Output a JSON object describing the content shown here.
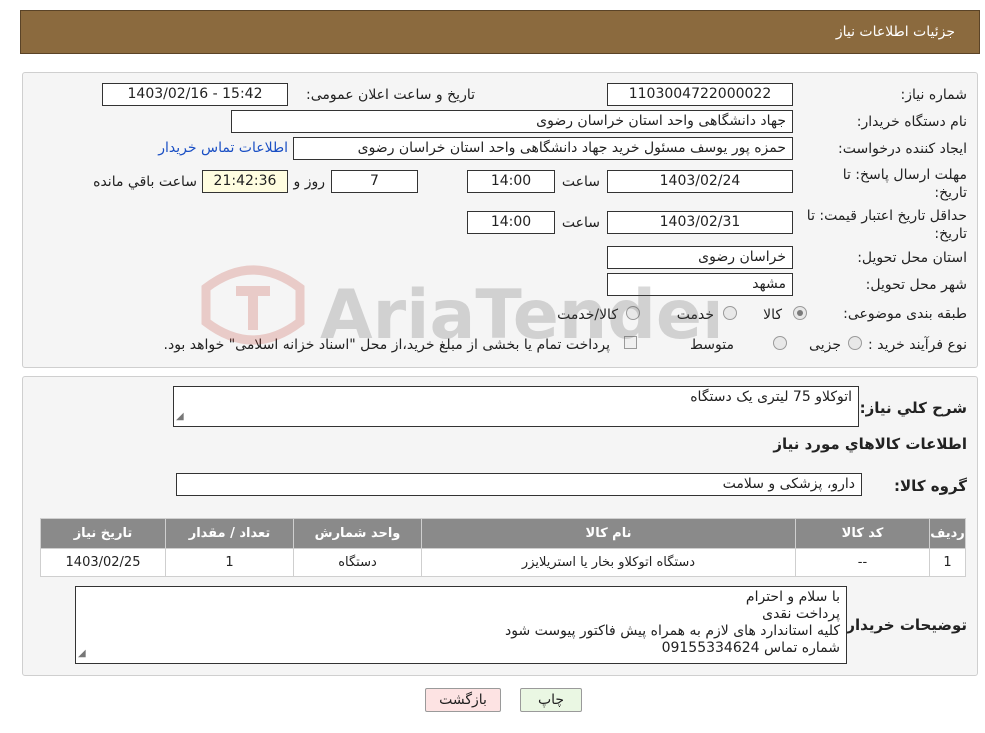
{
  "header": {
    "title": "جزئیات اطلاعات نیاز"
  },
  "form": {
    "need_number_label": "شماره نیاز:",
    "need_number": "1103004722000022",
    "announce_label": "تاریخ و ساعت اعلان عمومی:",
    "announce_value": "1403/02/16 - 15:42",
    "buyer_org_label": "نام دستگاه خریدار:",
    "buyer_org": "جهاد دانشگاهی واحد استان خراسان رضوی",
    "requester_label": "ایجاد کننده درخواست:",
    "requester": "حمزه  پور یوسف مسئول خرید جهاد دانشگاهی واحد استان خراسان رضوی",
    "contact_link": "اطلاعات تماس خریدار",
    "reply_deadline_label": "مهلت ارسال پاسخ: تا تاریخ:",
    "reply_date": "1403/02/24",
    "time_label": "ساعت",
    "reply_time": "14:00",
    "days_value": "7",
    "days_label": "روز و",
    "remaining_time": "21:42:36",
    "remaining_label": "ساعت باقي مانده",
    "price_validity_label": "حداقل تاریخ اعتبار قیمت: تا تاریخ:",
    "validity_date": "1403/02/31",
    "validity_time": "14:00",
    "province_label": "استان محل تحویل:",
    "province": "خراسان رضوی",
    "city_label": "شهر محل تحویل:",
    "city": "مشهد",
    "category_label": "طبقه بندی موضوعی:",
    "category_options": [
      "کالا",
      "خدمت",
      "کالا/خدمت"
    ],
    "category_selected": "کالا",
    "process_label": "نوع فرآیند خرید :",
    "process_options": [
      "جزیی",
      "متوسط"
    ],
    "process_note": "پرداخت تمام یا بخشی از مبلغ خرید،از محل \"اسناد خزانه اسلامی\" خواهد بود."
  },
  "watermark": {
    "text": "AriaTender.neT"
  },
  "details": {
    "summary_label": "شرح کلي نياز:",
    "summary": "اتوکلاو 75 لیتری یک دستگاه",
    "goods_info_title": "اطلاعات کالاهاي مورد نياز",
    "goods_group_label": "گروه کالا:",
    "goods_group": "دارو، پزشکی و سلامت",
    "table": {
      "headers": [
        "ردیف",
        "کد کالا",
        "نام کالا",
        "واحد شمارش",
        "تعداد / مقدار",
        "تاریخ نیاز"
      ],
      "rows": [
        [
          "1",
          "--",
          "دستگاه اتوکلاو بخار یا استریلایزر",
          "دستگاه",
          "1",
          "1403/02/25"
        ]
      ]
    },
    "buyer_notes_label": "توضیحات خریدار:",
    "buyer_notes": [
      "با سلام و احترام",
      "پرداخت نقدی",
      "کلیه استاندارد های لازم به همراه پیش فاکتور پیوست شود",
      "شماره تماس 09155334624"
    ]
  },
  "buttons": {
    "print": "چاپ",
    "back": "بازگشت"
  },
  "colors": {
    "header_bg": "#8b6a3e",
    "table_header_bg": "#8a8a8a",
    "link": "#1a4fc4",
    "back_btn_bg": "#fde3e3",
    "print_btn_bg": "#eaf7e3"
  }
}
